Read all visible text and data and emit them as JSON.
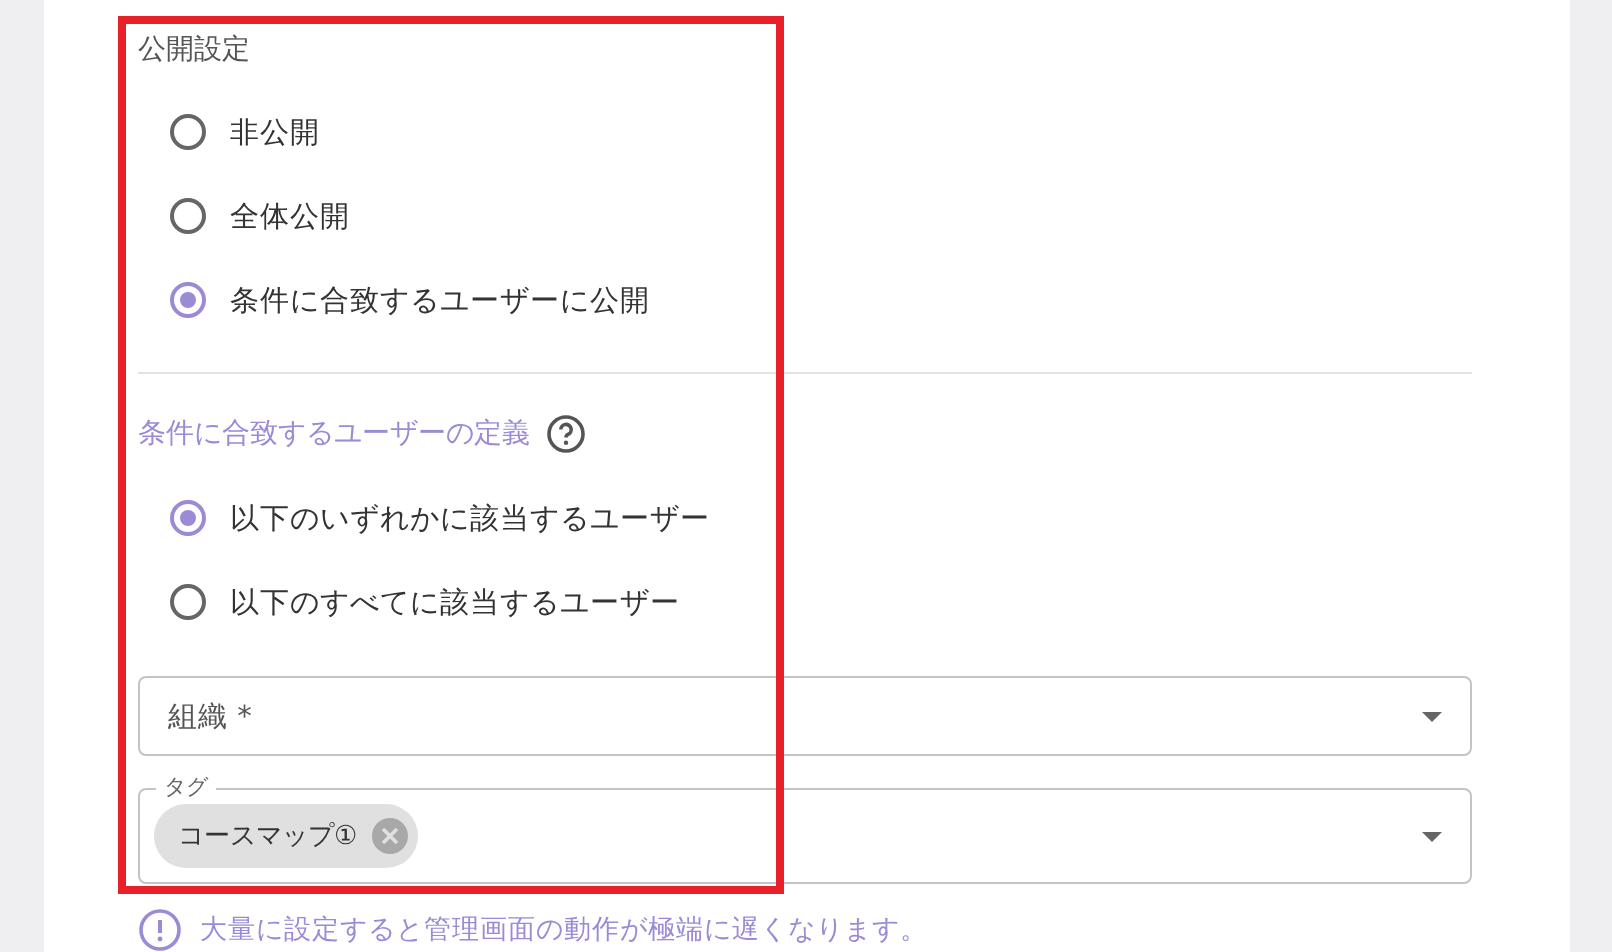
{
  "visibility": {
    "label": "公開設定",
    "options": [
      {
        "label": "非公開",
        "selected": false
      },
      {
        "label": "全体公開",
        "selected": false
      },
      {
        "label": "条件に合致するユーザーに公開",
        "selected": true
      }
    ]
  },
  "condition": {
    "label": "条件に合致するユーザーの定義",
    "options": [
      {
        "label": "以下のいずれかに該当するユーザー",
        "selected": true
      },
      {
        "label": "以下のすべてに該当するユーザー",
        "selected": false
      }
    ]
  },
  "organization_select": {
    "placeholder": "組織 *"
  },
  "tag_select": {
    "label": "タグ",
    "chips": [
      "コースマップ①"
    ]
  },
  "warning": "大量に設定すると管理画面の動作が極端に遅くなります。"
}
